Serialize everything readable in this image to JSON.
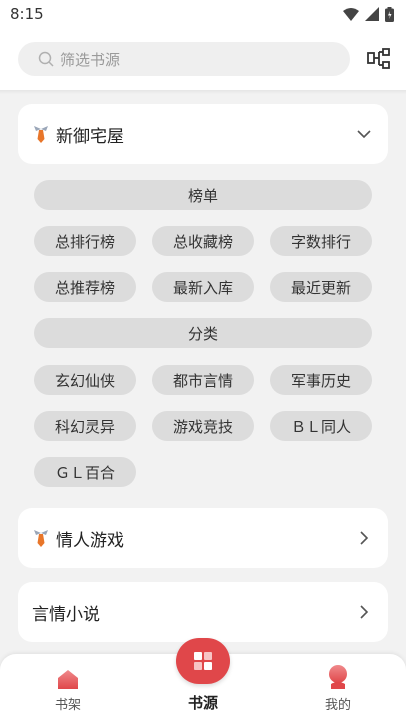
{
  "status_bar": {
    "time": "8:15"
  },
  "search": {
    "placeholder": "筛选书源"
  },
  "sources": [
    {
      "title": "新御宅屋",
      "expanded": true
    },
    {
      "title": "情人游戏",
      "expanded": false
    },
    {
      "title": "言情小说",
      "expanded": false
    }
  ],
  "groups": {
    "rank_header": "榜单",
    "rank_items": [
      "总排行榜",
      "总收藏榜",
      "字数排行",
      "总推荐榜",
      "最新入库",
      "最近更新"
    ],
    "category_header": "分类",
    "category_items": [
      "玄幻仙侠",
      "都市言情",
      "军事历史",
      "科幻灵异",
      "游戏竞技",
      "ＢＬ同人",
      "ＧＬ百合"
    ]
  },
  "bottom_nav": {
    "items": [
      {
        "label": "书架",
        "icon": "bookshelf-icon"
      },
      {
        "label": "书源",
        "icon": "book-source-icon"
      },
      {
        "label": "我的",
        "icon": "profile-icon"
      }
    ],
    "active_index": 1
  },
  "colors": {
    "accent": "#e0474a",
    "chip_bg": "#dcdcdc",
    "page_bg": "#f2f2f2"
  }
}
